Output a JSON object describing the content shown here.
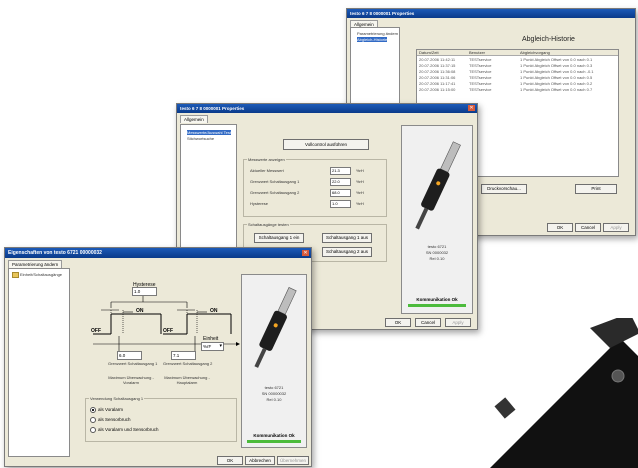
{
  "win1": {
    "title": "testo 6 7 8   0000001 Properties",
    "tab": "Allgemein",
    "tree": [
      "Parametrierung ändern",
      "Abgleich-Historie"
    ],
    "heading": "Abgleich-Historie",
    "columns": [
      "Datum/Zeit",
      "Benutzer",
      "Abgleichvorgang"
    ],
    "rows": [
      [
        "20.07.2006 11:42:11",
        "TESTservice",
        "1 Punkt Abgleich Offset von 0.0 nach 0.1"
      ],
      [
        "20.07.2006 11:37:15",
        "TESTservice",
        "1 Punkt Abgleich Offset von 0.0 nach 0.3"
      ],
      [
        "20.07.2006 11:36:08",
        "TESTservice",
        "1 Punkt Abgleich Offset von 0.0 nach -0.1"
      ],
      [
        "20.07.2006 11:31:06",
        "TESTservice",
        "1 Punkt Abgleich Offset von 0.0 nach 0.5"
      ],
      [
        "20.07.2006 11:17:41",
        "TESTservice",
        "1 Punkt Abgleich Offset von 0.0 nach 0.2"
      ],
      [
        "20.07.2006 11:15:00",
        "TESTservice",
        "1 Punkt Abgleich Offset von 0.0 nach 0.7"
      ]
    ],
    "btn_export": "Druckvorschau...",
    "btn_print": "Print",
    "ok": "OK",
    "cancel": "Cancel",
    "apply": "Apply"
  },
  "win2": {
    "title": "testo 6 7 8   0000001 Properties",
    "tab": "Allgemein",
    "tree": [
      "Messwerte/Auswahl Test",
      "Stichwortsuche"
    ],
    "btn_run": "Vollcontrol ausführen",
    "group1": "Messwerte anzeigen",
    "fields": [
      {
        "label": "Aktueller Messwert",
        "value": "21.3",
        "unit": "%rH"
      },
      {
        "label": "Grenzwert Schaltausgang 1",
        "value": "22.0",
        "unit": "%rH"
      },
      {
        "label": "Grenzwert Schaltausgang 2",
        "value": "68.0",
        "unit": "%rH"
      },
      {
        "label": "Hysterese",
        "value": "1.0",
        "unit": "%rH"
      }
    ],
    "group2": "Schaltausgänge testen",
    "buttons": [
      "Schaltausgang 1 ein",
      "Schaltausgang 1 aus",
      "Schaltausgang 2 ein",
      "Schaltausgang 2 aus"
    ],
    "device": [
      "testo 6721",
      "SN 0000032",
      "Rel 0.10"
    ],
    "status": "Kommunikation Ok",
    "ok": "OK",
    "cancel": "Cancel",
    "apply": "Apply"
  },
  "win3": {
    "title": "Eigenschaften von testo 6721  00000032",
    "tab": "Parametrierung ändern",
    "tree_item": "Einheit/Schaltausgänge",
    "hysteresis_label": "Hysterese",
    "hysteresis_value": "1.0",
    "on1": "ON",
    "on2": "ON",
    "off1": "OFF",
    "off2": "OFF",
    "unit_label": "Einheit",
    "unit_value": "%rF",
    "limit1": "6.0",
    "limit2": "7.1",
    "limit1_label": "Grenzwert Schaltausgang 1",
    "limit2_label": "Grenzwert Schaltausgang 2",
    "desc1": "Maximum Überwachung - Voralarm",
    "desc2": "Maximum Überwachung - Hauptalarm",
    "usage_title": "Verwendung Schaltausgang 1",
    "radios": [
      "als Voralarm",
      "als Sensorbruch",
      "als Voralarm und Sensorbruch"
    ],
    "selected_radio": 0,
    "device": [
      "testo 6721",
      "SN 00000032",
      "Rel 0.10"
    ],
    "status": "Kommunikation Ok",
    "ok": "OK",
    "cancel": "Abbrechen",
    "apply": "Übernehmen"
  },
  "colors": {
    "titlebar": "#0a3a8a",
    "status_green": "#4cbb3c",
    "device_dark": "#2a2a2a"
  }
}
